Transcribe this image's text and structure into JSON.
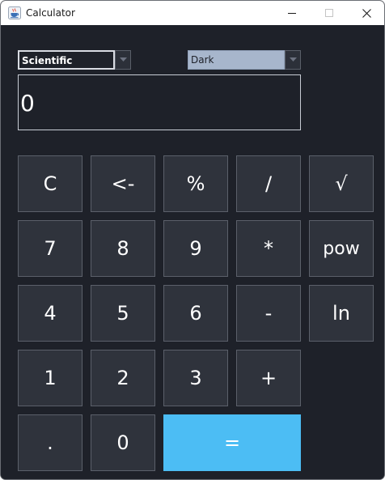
{
  "window": {
    "title": "Calculator",
    "app_icon": "java-cup-icon",
    "controls": [
      "minimize-icon",
      "maximize-icon",
      "close-icon"
    ]
  },
  "mode_selector": {
    "selected": "Scientific"
  },
  "theme_selector": {
    "selected": "Dark"
  },
  "display": {
    "value": "0"
  },
  "keys": {
    "clear": "C",
    "backspace": "<-",
    "percent": "%",
    "divide": "/",
    "sqrt": "√",
    "seven": "7",
    "eight": "8",
    "nine": "9",
    "multiply": "*",
    "pow": "pow",
    "four": "4",
    "five": "5",
    "six": "6",
    "subtract": "-",
    "ln": "ln",
    "one": "1",
    "two": "2",
    "three": "3",
    "add": "+",
    "decimal": ".",
    "zero": "0",
    "equals": "="
  },
  "colors": {
    "background": "#1e2129",
    "key": "#2f333c",
    "key_border": "#5b606a",
    "accent": "#4cbdf4",
    "theme_field": "#a7b6cc",
    "text": "#ffffff"
  }
}
